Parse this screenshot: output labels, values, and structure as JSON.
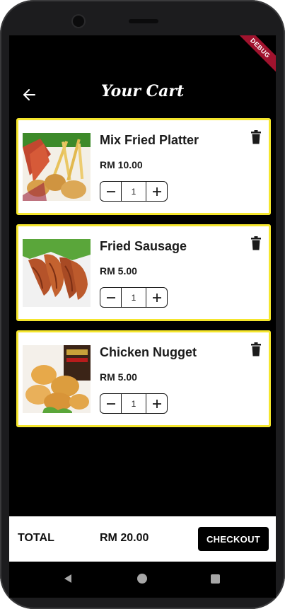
{
  "header": {
    "title": "Your Cart",
    "debug_label": "DEBUG"
  },
  "cart": {
    "items": [
      {
        "name": "Mix Fried Platter",
        "price": "RM 10.00",
        "qty": "1",
        "image": "fried-platter-photo"
      },
      {
        "name": "Fried Sausage",
        "price": "RM 5.00",
        "qty": "1",
        "image": "fried-sausage-photo"
      },
      {
        "name": "Chicken Nugget",
        "price": "RM 5.00",
        "qty": "1",
        "image": "chicken-nugget-photo"
      }
    ]
  },
  "summary": {
    "total_label": "TOTAL",
    "total_value": "RM 20.00",
    "checkout_label": "CHECKOUT"
  },
  "colors": {
    "accent_border": "#f5e62d",
    "background": "#000000",
    "card": "#ffffff",
    "debug_ribbon": "#a1132e"
  }
}
